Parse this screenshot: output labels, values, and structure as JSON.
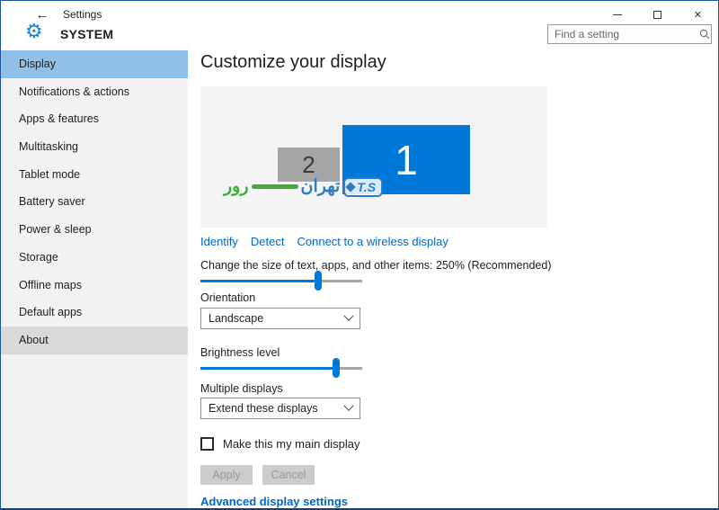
{
  "window": {
    "title": "Settings"
  },
  "titlebar": {
    "back_glyph": "←",
    "close_glyph": "✕"
  },
  "header": {
    "gear_glyph": "⚙",
    "page_title": "SYSTEM",
    "search_placeholder": "Find a setting"
  },
  "sidebar": {
    "items": [
      {
        "label": "Display",
        "state": "selected"
      },
      {
        "label": "Notifications & actions",
        "state": "normal"
      },
      {
        "label": "Apps & features",
        "state": "normal"
      },
      {
        "label": "Multitasking",
        "state": "normal"
      },
      {
        "label": "Tablet mode",
        "state": "normal"
      },
      {
        "label": "Battery saver",
        "state": "normal"
      },
      {
        "label": "Power & sleep",
        "state": "normal"
      },
      {
        "label": "Storage",
        "state": "normal"
      },
      {
        "label": "Offline maps",
        "state": "normal"
      },
      {
        "label": "Default apps",
        "state": "normal"
      },
      {
        "label": "About",
        "state": "hovered"
      }
    ]
  },
  "main": {
    "heading": "Customize your display",
    "monitors": [
      {
        "number": "1",
        "color": "#0078d7"
      },
      {
        "number": "2",
        "color": "#a5a5a5"
      }
    ],
    "watermark": {
      "green_text": "رور",
      "blue_text": "تهران",
      "box_text": "T.S"
    },
    "links": [
      "Identify",
      "Detect",
      "Connect to a wireless display"
    ],
    "scale": {
      "label": "Change the size of text, apps, and other items: 250% (Recommended)",
      "percent": 73
    },
    "orientation": {
      "label": "Orientation",
      "value": "Landscape"
    },
    "brightness": {
      "label": "Brightness level",
      "percent": 84
    },
    "multiple_displays": {
      "label": "Multiple displays",
      "value": "Extend these displays"
    },
    "checkbox": {
      "label": "Make this my main display",
      "checked": false
    },
    "buttons": {
      "apply": "Apply",
      "cancel": "Cancel"
    },
    "advanced_link": "Advanced display settings"
  },
  "colors": {
    "accent": "#0078d7",
    "sidebar_selected": "#90c0e8",
    "sidebar_hover": "#d9d9d9",
    "link": "#0066cc",
    "window_border": "#1b55a3",
    "preview_bg": "#f4f4f4",
    "disabled_button_bg": "#cccccc",
    "watermark_blue": "#2e7cc4",
    "watermark_green": "#3cb036"
  }
}
